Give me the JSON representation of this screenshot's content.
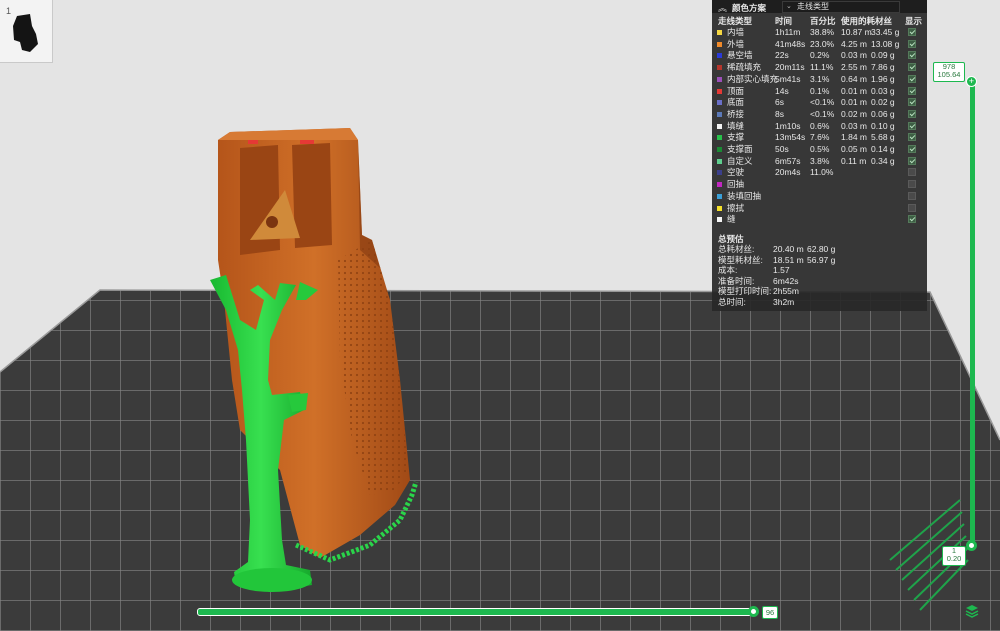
{
  "thumbnail": {
    "index": "1"
  },
  "legend": {
    "scheme_label": "颜色方案",
    "scheme_value": "走线类型",
    "headers": {
      "type": "走线类型",
      "time": "时间",
      "percent": "百分比",
      "filament": "使用的耗材丝",
      "display": "显示"
    },
    "rows": [
      {
        "name": "内墙",
        "color": "#f5d742",
        "time": "1h11m",
        "percent": "38.8%",
        "length": "10.87 m",
        "weight": "33.45 g",
        "visible": true
      },
      {
        "name": "外墙",
        "color": "#f08a2a",
        "time": "41m48s",
        "percent": "23.0%",
        "length": "4.25 m",
        "weight": "13.08 g",
        "visible": true
      },
      {
        "name": "悬空墙",
        "color": "#2a3ad8",
        "time": "22s",
        "percent": "0.2%",
        "length": "0.03 m",
        "weight": "0.09 g",
        "visible": true
      },
      {
        "name": "稀疏填充",
        "color": "#b5352c",
        "time": "20m11s",
        "percent": "11.1%",
        "length": "2.55 m",
        "weight": "7.86 g",
        "visible": true
      },
      {
        "name": "内部实心填充",
        "color": "#9b4fb8",
        "time": "5m41s",
        "percent": "3.1%",
        "length": "0.64 m",
        "weight": "1.96 g",
        "visible": true
      },
      {
        "name": "顶面",
        "color": "#e53935",
        "time": "14s",
        "percent": "0.1%",
        "length": "0.01 m",
        "weight": "0.03 g",
        "visible": true
      },
      {
        "name": "底面",
        "color": "#6a6fc8",
        "time": "6s",
        "percent": "<0.1%",
        "length": "0.01 m",
        "weight": "0.02 g",
        "visible": true
      },
      {
        "name": "桥接",
        "color": "#5b79b8",
        "time": "8s",
        "percent": "<0.1%",
        "length": "0.02 m",
        "weight": "0.06 g",
        "visible": true
      },
      {
        "name": "填缝",
        "color": "#f2f2f2",
        "time": "1m10s",
        "percent": "0.6%",
        "length": "0.03 m",
        "weight": "0.10 g",
        "visible": true
      },
      {
        "name": "支撑",
        "color": "#27c04a",
        "time": "13m54s",
        "percent": "7.6%",
        "length": "1.84 m",
        "weight": "5.68 g",
        "visible": true
      },
      {
        "name": "支撑面",
        "color": "#1a8a34",
        "time": "50s",
        "percent": "0.5%",
        "length": "0.05 m",
        "weight": "0.14 g",
        "visible": true
      },
      {
        "name": "自定义",
        "color": "#5fcf8e",
        "time": "6m57s",
        "percent": "3.8%",
        "length": "0.11 m",
        "weight": "0.34 g",
        "visible": true
      },
      {
        "name": "空驶",
        "color": "#3b3f8c",
        "time": "20m4s",
        "percent": "11.0%",
        "length": "",
        "weight": "",
        "visible": false
      },
      {
        "name": "回抽",
        "color": "#c026c0",
        "time": "",
        "percent": "",
        "length": "",
        "weight": "",
        "visible": false
      },
      {
        "name": "装填回抽",
        "color": "#3aa0d8",
        "time": "",
        "percent": "",
        "length": "",
        "weight": "",
        "visible": false
      },
      {
        "name": "擦拭",
        "color": "#f5e02a",
        "time": "",
        "percent": "",
        "length": "",
        "weight": "",
        "visible": false
      },
      {
        "name": "缝",
        "color": "#f5f5f5",
        "time": "",
        "percent": "",
        "length": "",
        "weight": "",
        "visible": true
      }
    ],
    "estimate_title": "总预估",
    "estimates": [
      {
        "key": "总耗材丝:",
        "v1": "20.40 m",
        "v2": "62.80 g"
      },
      {
        "key": "模型耗材丝:",
        "v1": "18.51 m",
        "v2": "56.97 g"
      },
      {
        "key": "成本:",
        "v1": "1.57",
        "v2": ""
      },
      {
        "key": "准备时间:",
        "v1": "6m42s",
        "v2": ""
      },
      {
        "key": "模型打印时间:",
        "v1": "2h55m",
        "v2": ""
      },
      {
        "key": "总时间:",
        "v1": "3h2m",
        "v2": ""
      }
    ]
  },
  "layer_slider": {
    "top_layer": "978",
    "top_height": "105.64",
    "bottom_layer": "1",
    "bottom_height": "0.20",
    "add_icon": "plus-icon"
  },
  "move_slider": {
    "value": "96"
  },
  "colors": {
    "accent": "#1db84f",
    "model": "#c8641e",
    "support": "#22d43c",
    "bed": "#3c3c3c"
  }
}
